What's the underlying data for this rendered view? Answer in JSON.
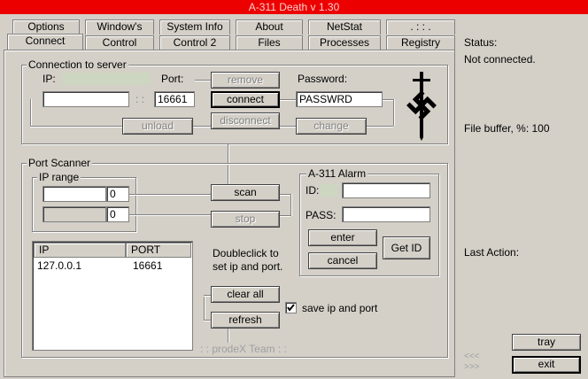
{
  "window": {
    "title": "A-311 Death v 1.30"
  },
  "tabs_back": [
    "Options",
    "Window's",
    "System Info",
    "About",
    "NetStat",
    ". : : ."
  ],
  "tabs_front": [
    "Connect",
    "Control",
    "Control 2",
    "Files",
    "Processes",
    "Registry"
  ],
  "connection": {
    "group_label": "Connection to server",
    "ip_label": "IP:",
    "ip_value": "",
    "port_label": "Port:",
    "port_value": "16661",
    "separator": ": :",
    "password_label": "Password:",
    "password_value": "PASSWRD",
    "remove": "remove",
    "connect": "connect",
    "disconnect": "disconnect",
    "unload": "unload",
    "change": "change",
    "logo": "logo-icon"
  },
  "scanner": {
    "group_label": "Port Scanner",
    "ip_range_label": "IP range",
    "from_ip": "",
    "from_suffix": "0",
    "to_ip": "",
    "to_suffix": "0",
    "scan": "scan",
    "stop": "stop",
    "list_headers": [
      "IP",
      "PORT"
    ],
    "list_rows": [
      {
        "ip": "127.0.0.1",
        "port": "16661"
      }
    ],
    "hint_line1": "Doubleclick to",
    "hint_line2": "set ip and port.",
    "clear_all": "clear all",
    "refresh": "refresh",
    "save_checkbox_label": "save ip and port",
    "save_checked": true,
    "credit": ": : prodeX Team : :"
  },
  "alarm": {
    "group_label": "A-311 Alarm",
    "id_label": "ID:",
    "id_value": "",
    "pass_label": "PASS:",
    "pass_value": "",
    "enter": "enter",
    "cancel": "cancel",
    "get_id": "Get ID"
  },
  "status": {
    "status_label": "Status:",
    "status_value": "Not connected.",
    "buffer_text": "File buffer, %: 100",
    "last_action_label": "Last Action:",
    "arrows_left": "<<<",
    "arrows_right": ">>>",
    "tray": "tray",
    "exit": "exit"
  },
  "colors": {
    "title_bg": "#ec0000",
    "face": "#d4d0c8"
  }
}
